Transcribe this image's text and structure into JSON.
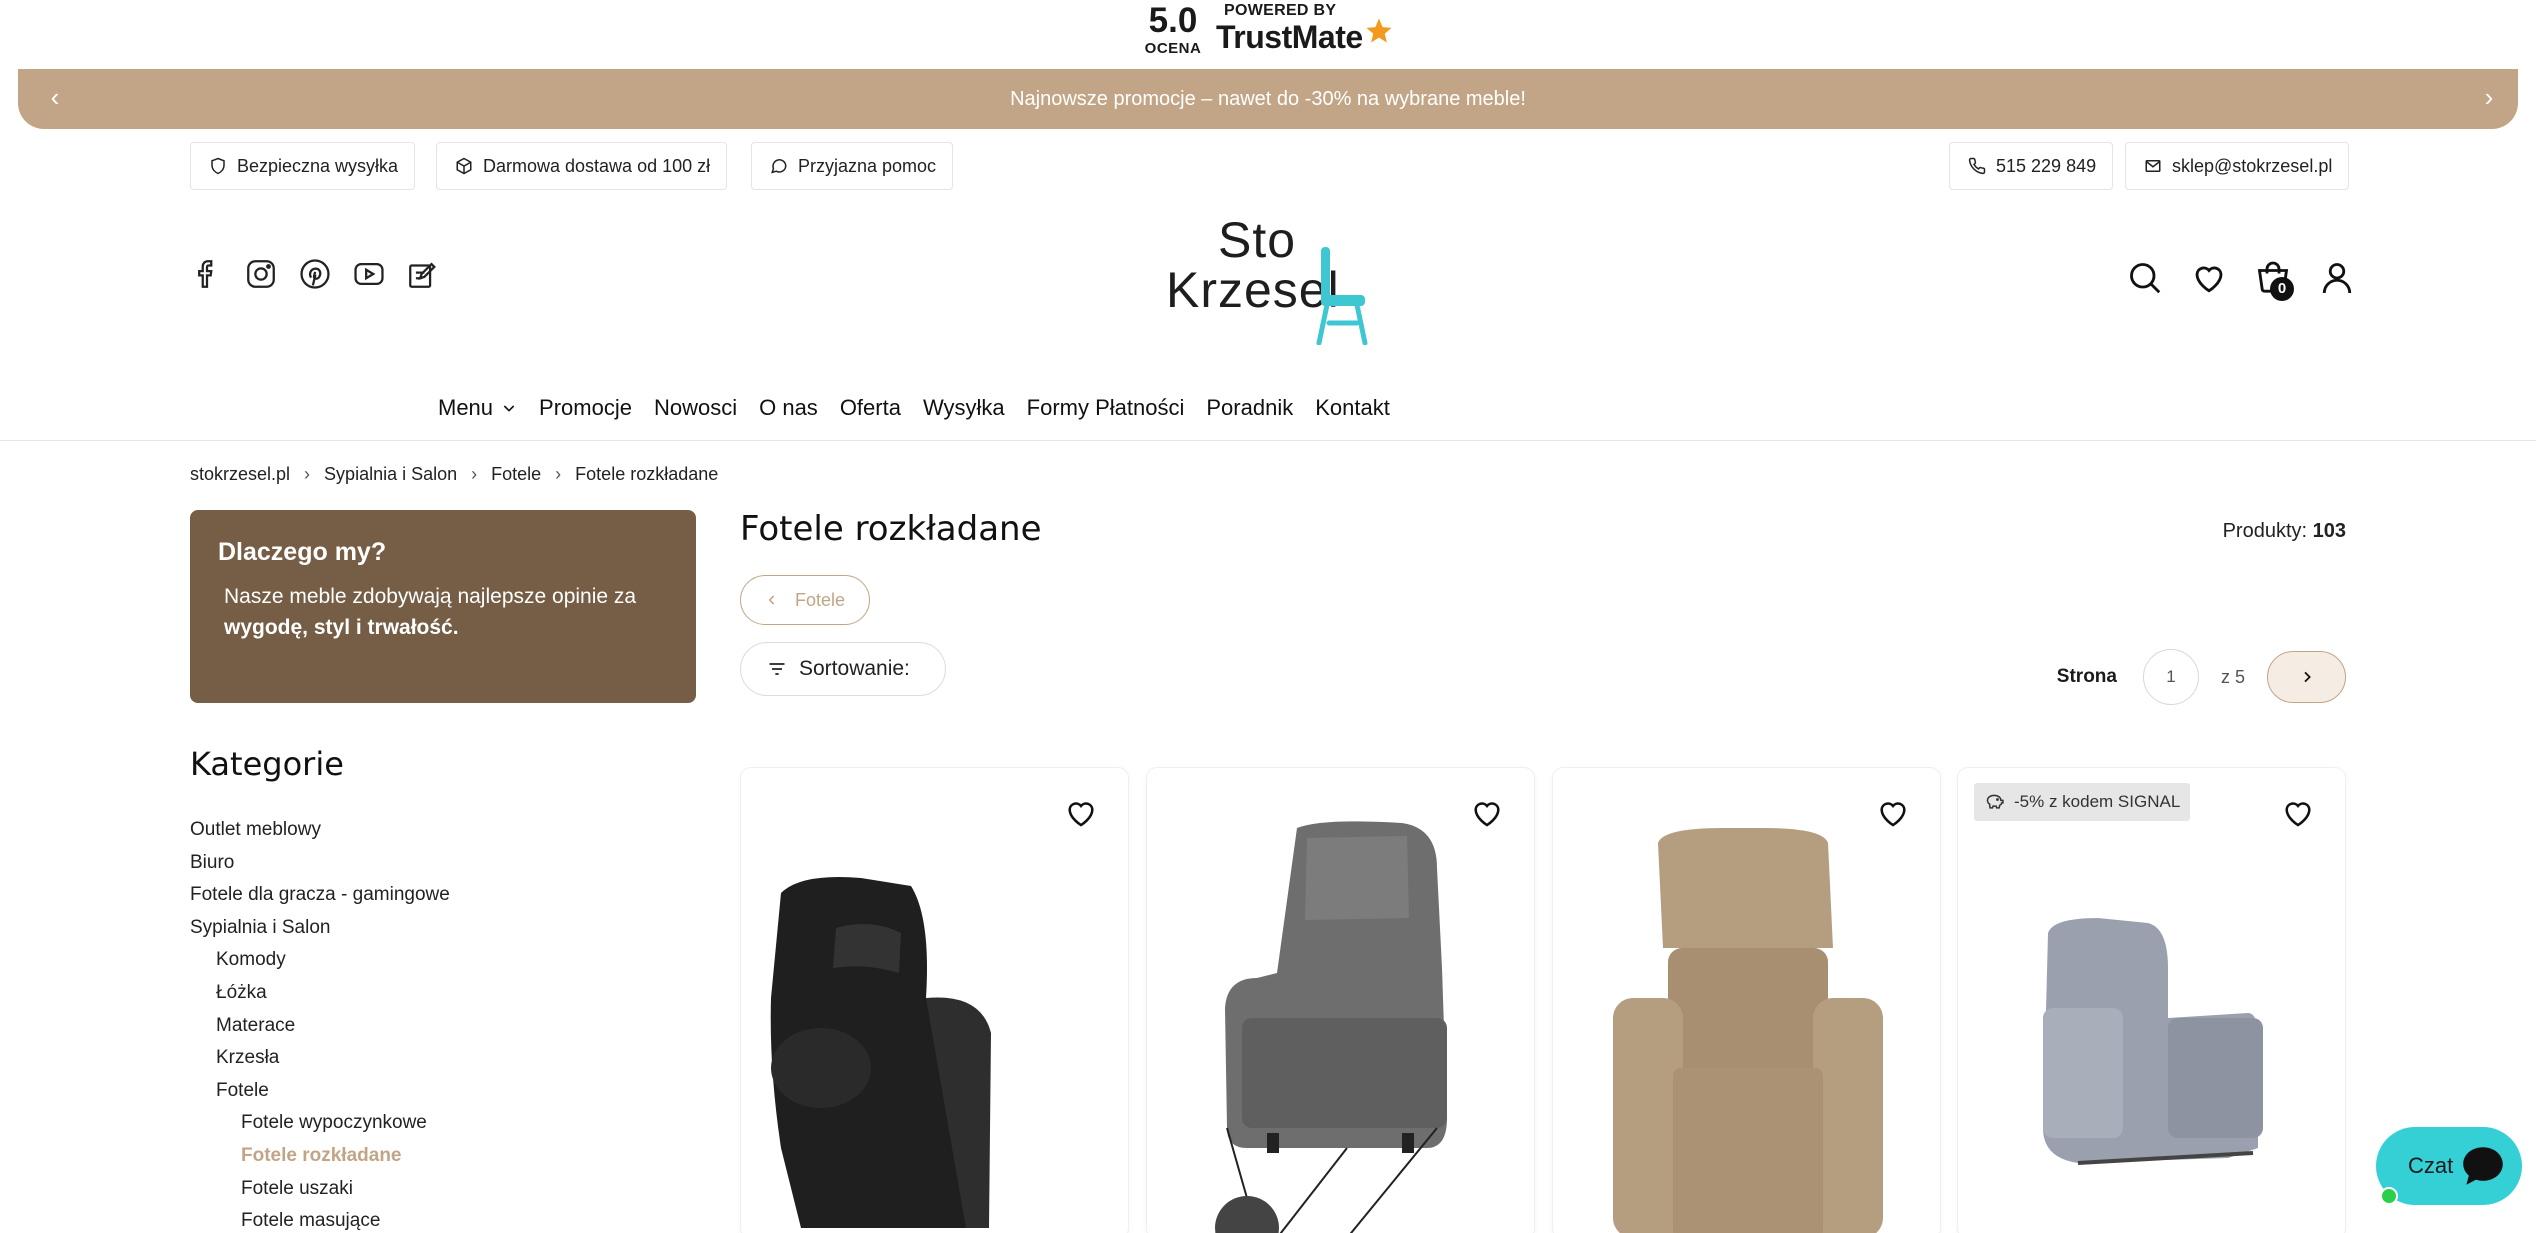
{
  "trustmate": {
    "score": "5.0",
    "score_label": "OCENA",
    "powered_by": "POWERED BY",
    "brand": "TrustMate"
  },
  "promo_bar": {
    "text": "Najnowsze promocje – nawet do -30% na wybrane meble!",
    "prev": "‹",
    "next": "›"
  },
  "info_pills": {
    "shipping": "Bezpieczna wysyłka",
    "free_delivery": "Darmowa dostawa od 100 zł",
    "help": "Przyjazna pomoc",
    "phone": "515 229 849",
    "email": "sklep@stokrzesel.pl"
  },
  "logo": {
    "line1": "Sto",
    "line2": "Krzesel",
    "chair_color": "#3ec7d3"
  },
  "social_icons": [
    "facebook-icon",
    "instagram-icon",
    "pinterest-icon",
    "youtube-icon",
    "blog-icon"
  ],
  "header_icons": {
    "cart_count": "0"
  },
  "nav": {
    "menu": "Menu",
    "items": [
      "Promocje",
      "Nowosci",
      "O nas",
      "Oferta",
      "Wysyłka",
      "Formy Płatności",
      "Poradnik",
      "Kontakt"
    ]
  },
  "breadcrumb": [
    "stokrzesel.pl",
    "Sypialnia i Salon",
    "Fotele",
    "Fotele rozkładane"
  ],
  "why_us": {
    "title": "Dlaczego my?",
    "text": "Nasze meble zdobywają najlepsze opinie za",
    "bold": "wygodę, styl i trwałość."
  },
  "categories": {
    "title": "Kategorie",
    "items": [
      {
        "label": "Outlet meblowy",
        "depth": 0
      },
      {
        "label": "Biuro",
        "depth": 0
      },
      {
        "label": "Fotele dla gracza - gamingowe",
        "depth": 0
      },
      {
        "label": "Sypialnia i Salon",
        "depth": 0
      },
      {
        "label": "Komody",
        "depth": 1
      },
      {
        "label": "Łóżka",
        "depth": 1
      },
      {
        "label": "Materace",
        "depth": 1
      },
      {
        "label": "Krzesła",
        "depth": 1
      },
      {
        "label": "Fotele",
        "depth": 1
      },
      {
        "label": "Fotele wypoczynkowe",
        "depth": 2
      },
      {
        "label": "Fotele rozkładane",
        "depth": 2,
        "active": true
      },
      {
        "label": "Fotele uszaki",
        "depth": 2
      },
      {
        "label": "Fotele masujące",
        "depth": 2
      }
    ]
  },
  "listing": {
    "title": "Fotele rozkładane",
    "count_label": "Produkty:",
    "count": "103",
    "back_label": "Fotele",
    "sort_label": "Sortowanie:",
    "page_label": "Strona",
    "page_current": "1",
    "page_of": "z 5"
  },
  "products": [
    {
      "color": "#1f1f1f",
      "promo": ""
    },
    {
      "color": "#6e6e6e",
      "promo": ""
    },
    {
      "color": "#b59d80",
      "promo": ""
    },
    {
      "color": "#9aa0ad",
      "promo": "-5% z kodem SIGNAL"
    }
  ],
  "chat": {
    "label": "Czat"
  },
  "colors": {
    "accent": "#c2a587",
    "why_bg": "#755d46",
    "chat": "#35cfd6"
  }
}
